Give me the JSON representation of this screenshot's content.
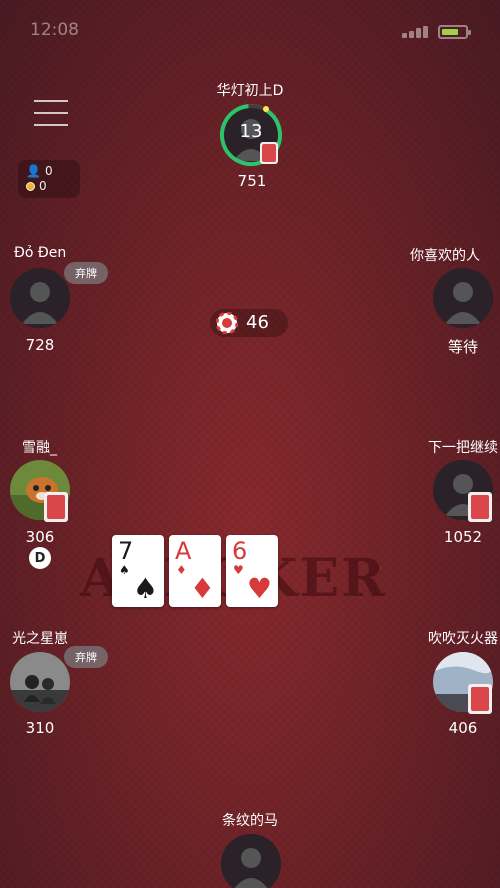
{
  "status_bar": {
    "time": "12:08"
  },
  "info_box": {
    "users_count": "0",
    "coins_count": "0"
  },
  "pot": {
    "amount": "46"
  },
  "watermark": "AEPOKER",
  "players": {
    "top": {
      "name": "华灯初上D",
      "timer": "13",
      "chips": "751"
    },
    "left_1": {
      "name": "Đỏ Đen",
      "chips": "728",
      "action": "弃牌"
    },
    "right_1": {
      "name": "你喜欢的人",
      "status": "等待"
    },
    "left_2": {
      "name": "雪融_",
      "chips": "306",
      "dealer": "D"
    },
    "right_2": {
      "name": "下一把继续",
      "chips": "1052"
    },
    "left_3": {
      "name": "光之星崽",
      "chips": "310",
      "action": "弃牌"
    },
    "right_3": {
      "name": "吹吹灭火器",
      "chips": "406"
    },
    "bottom": {
      "name": "条纹的马"
    }
  },
  "community_cards": [
    {
      "rank": "7",
      "suit": "♠",
      "color": "black"
    },
    {
      "rank": "A",
      "suit": "♦",
      "color": "red"
    },
    {
      "rank": "6",
      "suit": "♥",
      "color": "red"
    }
  ],
  "colors": {
    "timer_ring": "#2ec26a",
    "card_back": "#d9474b",
    "table": "#6e2328"
  }
}
